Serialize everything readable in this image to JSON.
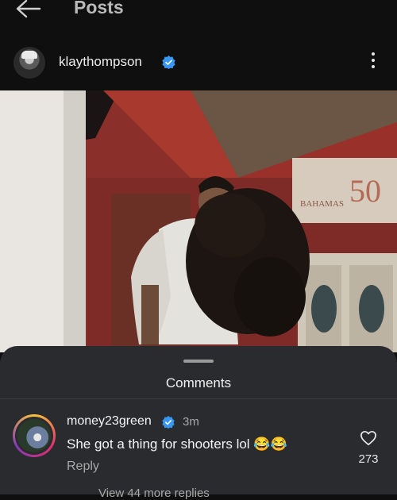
{
  "nav": {
    "title": "Posts"
  },
  "post": {
    "username": "klaythompson"
  },
  "photo": {
    "sign_text": "BAHAMAS"
  },
  "comments_sheet": {
    "title": "Comments",
    "comment": {
      "username": "money23green",
      "time": "3m",
      "text": "She got a thing for shooters lol 😂😂",
      "reply_label": "Reply",
      "likes": "273",
      "view_replies": "View 44 more replies"
    }
  },
  "colors": {
    "verified": "#3897f0",
    "background": "#0f0f10",
    "sheet": "#2a2b2e"
  }
}
